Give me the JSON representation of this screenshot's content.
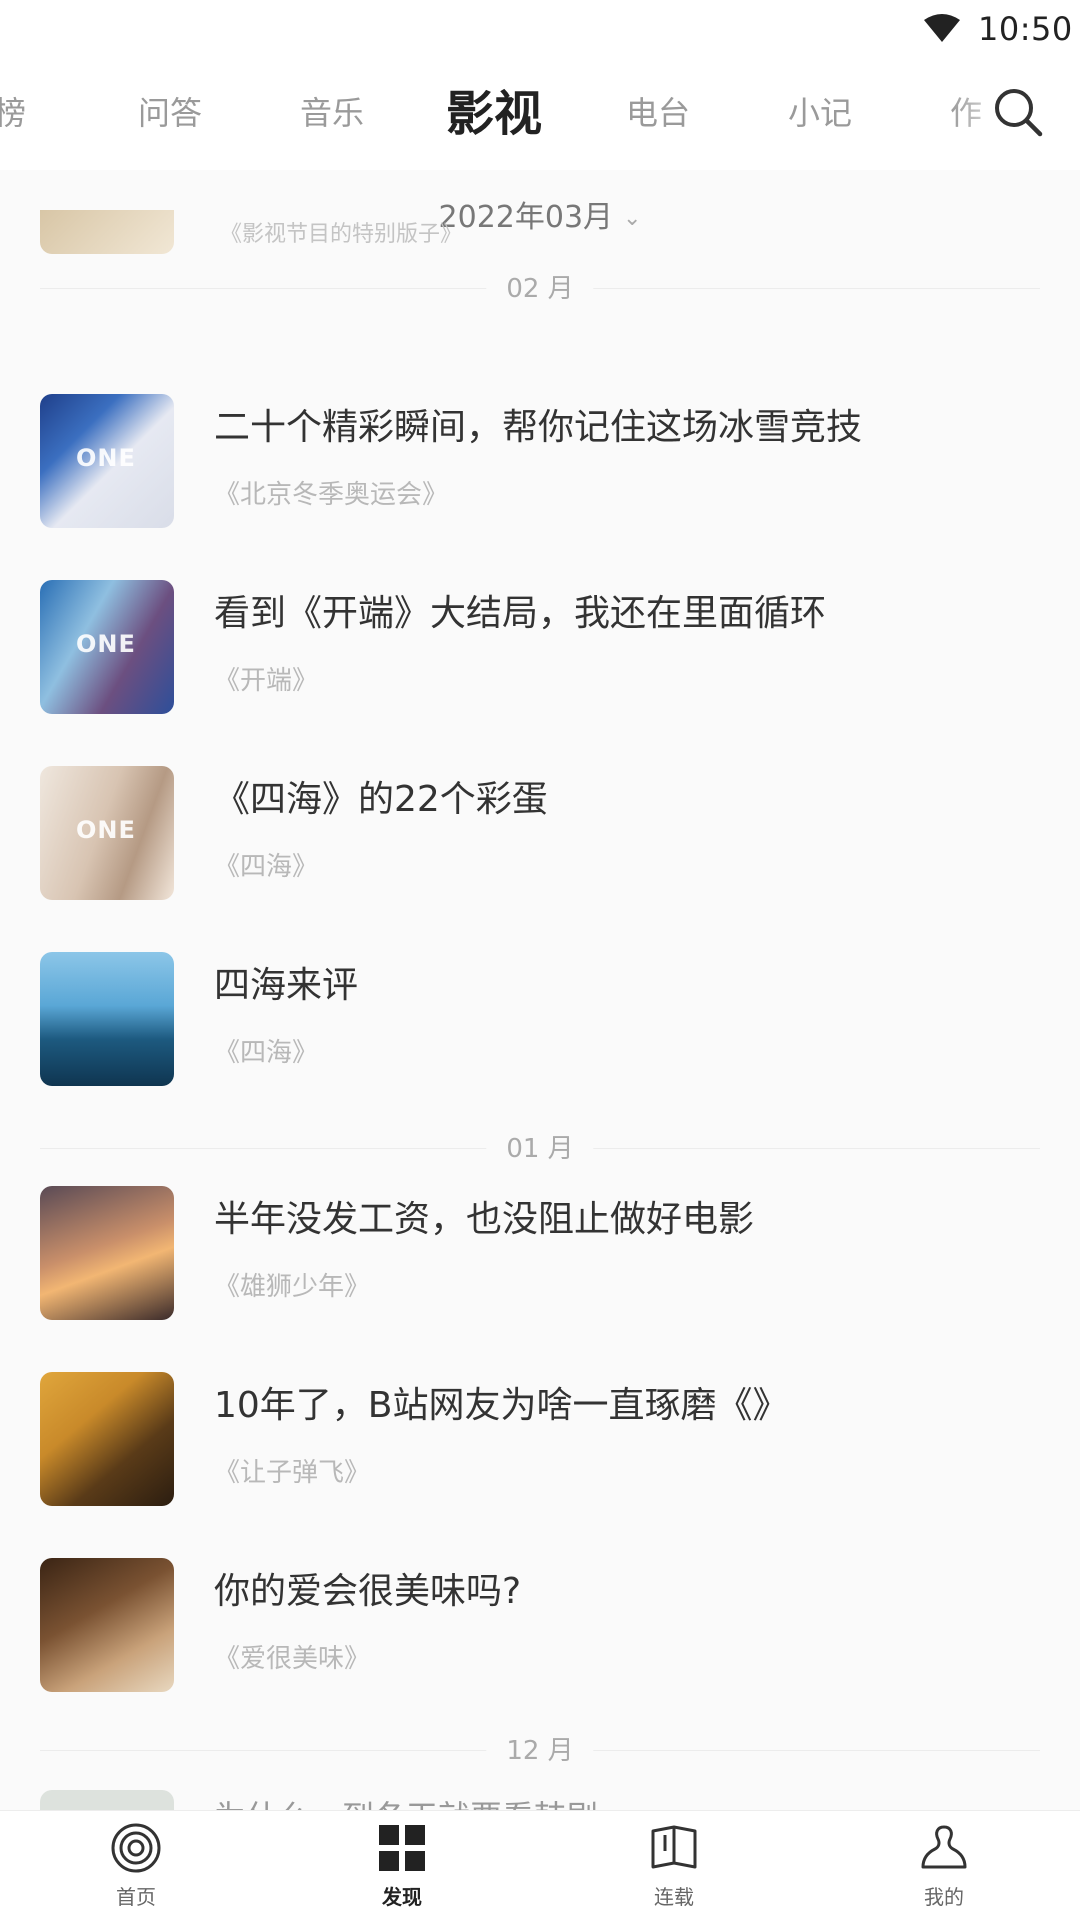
{
  "status_bar": {
    "time": "10:50"
  },
  "tabs": [
    {
      "label": "榜"
    },
    {
      "label": "问答"
    },
    {
      "label": "音乐"
    },
    {
      "label": "影视",
      "active": true
    },
    {
      "label": "电台"
    },
    {
      "label": "小记"
    },
    {
      "label": "作"
    }
  ],
  "month_picker": {
    "label": "2022年03月"
  },
  "partial_top": {
    "subtitle": "《影视节目的特别版子》"
  },
  "sections": [
    {
      "month": "02 月",
      "items": [
        {
          "title": "二十个精彩瞬间，帮你记住这场冰雪竞技",
          "subtitle": "《北京冬季奥运会》",
          "thumb_colors": [
            "#1f3f8a",
            "#d9dde8"
          ],
          "watermark": "ONE"
        },
        {
          "title": "看到《开端》大结局，我还在里面循环",
          "subtitle": "《开端》",
          "thumb_colors": [
            "#2a6fb5",
            "#7a5a8a"
          ],
          "watermark": "ONE"
        },
        {
          "title": "《四海》的22个彩蛋",
          "subtitle": "《四海》",
          "thumb_colors": [
            "#e8dcd0",
            "#b59a84"
          ],
          "watermark": "ONE"
        },
        {
          "title": "四海来评",
          "subtitle": "《四海》",
          "thumb_colors": [
            "#5aa7d6",
            "#0f3550"
          ],
          "watermark": ""
        }
      ]
    },
    {
      "month": "01 月",
      "items": [
        {
          "title": "半年没发工资，也没阻止做好电影",
          "subtitle": "《雄狮少年》",
          "thumb_colors": [
            "#e9b47a",
            "#3a2a2a"
          ],
          "watermark": ""
        },
        {
          "title": "10年了，B站网友为啥一直琢磨《》",
          "subtitle": "《让子弹飞》",
          "thumb_colors": [
            "#c98a2a",
            "#2b1d10"
          ],
          "watermark": ""
        },
        {
          "title": "你的爱会很美味吗?",
          "subtitle": "《爱很美味》",
          "thumb_colors": [
            "#5a3a22",
            "#c9a27a"
          ],
          "watermark": ""
        }
      ]
    }
  ],
  "next_section": {
    "month": "12 月"
  },
  "partial_bottom": {
    "title": "为什么一到冬天就要看韩剧"
  },
  "bottom_nav": [
    {
      "label": "首页",
      "icon": "home-circle-icon"
    },
    {
      "label": "发现",
      "icon": "discover-grid-icon",
      "active": true
    },
    {
      "label": "连载",
      "icon": "book-icon"
    },
    {
      "label": "我的",
      "icon": "profile-icon"
    }
  ]
}
